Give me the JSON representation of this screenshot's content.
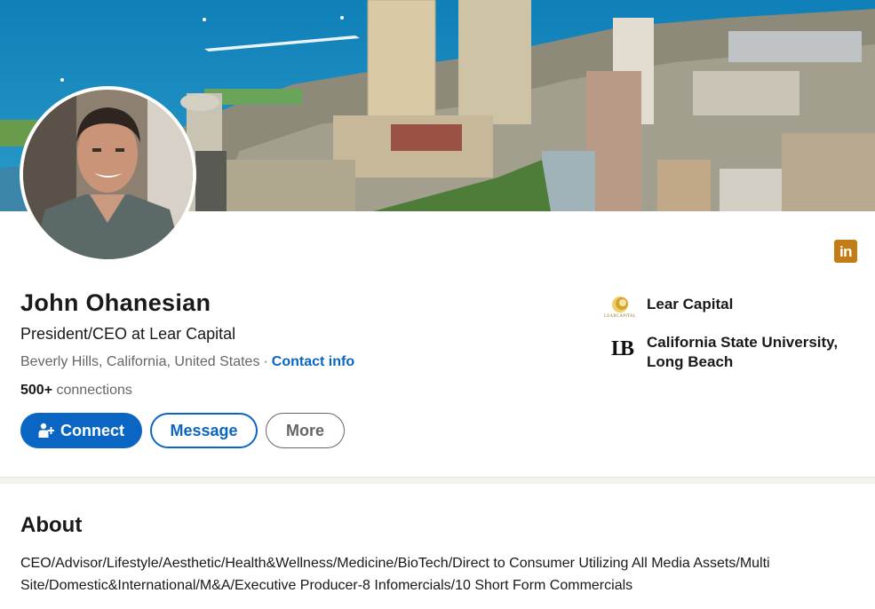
{
  "profile": {
    "name": "John Ohanesian",
    "headline": "President/CEO at Lear Capital",
    "location": "Beverly Hills, California, United States",
    "separator": "·",
    "contact_label": "Contact info",
    "connections_count": "500+",
    "connections_label": "connections"
  },
  "actions": {
    "connect_label": "Connect",
    "message_label": "Message",
    "more_label": "More"
  },
  "brand": {
    "linkedin_icon_text": "in",
    "linkedin_color": "#c37d16",
    "accent": "#0a66c2"
  },
  "orgs": [
    {
      "label": "Lear Capital",
      "logo_text": "LEARCAPITAL",
      "icon": "lear-capital-logo"
    },
    {
      "label": "California State University, Long Beach",
      "logo_text": "LB",
      "icon": "csulb-logo"
    }
  ],
  "about": {
    "title": "About",
    "text": "CEO/Advisor/Lifestyle/Aesthetic/Health&Wellness/Medicine/BioTech/Direct to Consumer Utilizing All Media Assets/Multi Site/Domestic&International/M&A/Executive Producer-8 Infomercials/10 Short Form Commercials"
  }
}
